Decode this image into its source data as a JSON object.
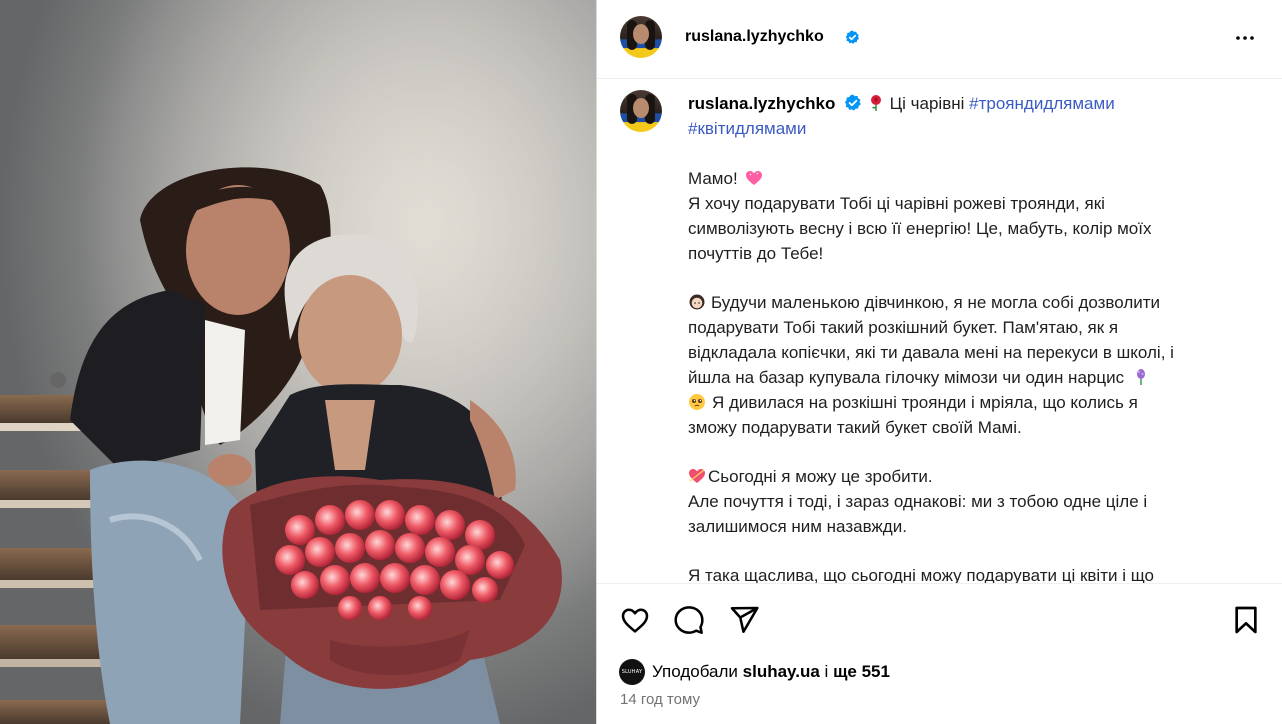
{
  "post": {
    "username": "ruslana.lyzhychko",
    "more_icon": "more-horizontal-icon"
  },
  "caption": {
    "username": "ruslana.lyzhychko",
    "intro_text": "Ці чарівні",
    "hashtag_1": "#трояндидлямами",
    "hashtag_2": "#квітидлямами",
    "lines": [
      "Мамо!",
      "Я хочу подарувати Тобі ці чарівні рожеві троянди, які",
      "символізують весну і всю її енергію! Це, мабуть, колір моїх",
      "почуттів до Тебе!",
      "Будучи маленькою дівчинкою, я не могла собі дозволити",
      "подарувати Тобі такий розкішний букет. Пам'ятаю, як я",
      "відкладала копієчки, які ти давала мені на перекуси в школі, і",
      "йшла на базар купувала гілочку мімози чи один нарцис",
      "Я дивилася на розкішні троянди і мріяла, що колись я",
      "зможу подарувати такий букет своїй Мамі.",
      "Сьогодні я можу це зробити.",
      "Але почуття і тоді, і зараз однакові: ми з тобою одне ціле і",
      "залишимося ним назавжди.",
      "Я така щаслива, що сьогодні можу подарувати ці квіти і що"
    ]
  },
  "actions": {
    "likes_prefix": "Уподобали",
    "likes_user": "sluhay.ua",
    "likes_middle": "і",
    "likes_rest": "ще 551",
    "liker_avatar_text": "SLUHAY",
    "time_ago": "14 год тому"
  },
  "colors": {
    "hashtag": "#3b5bc4",
    "verified": "#0095f6",
    "muted": "#737373"
  }
}
